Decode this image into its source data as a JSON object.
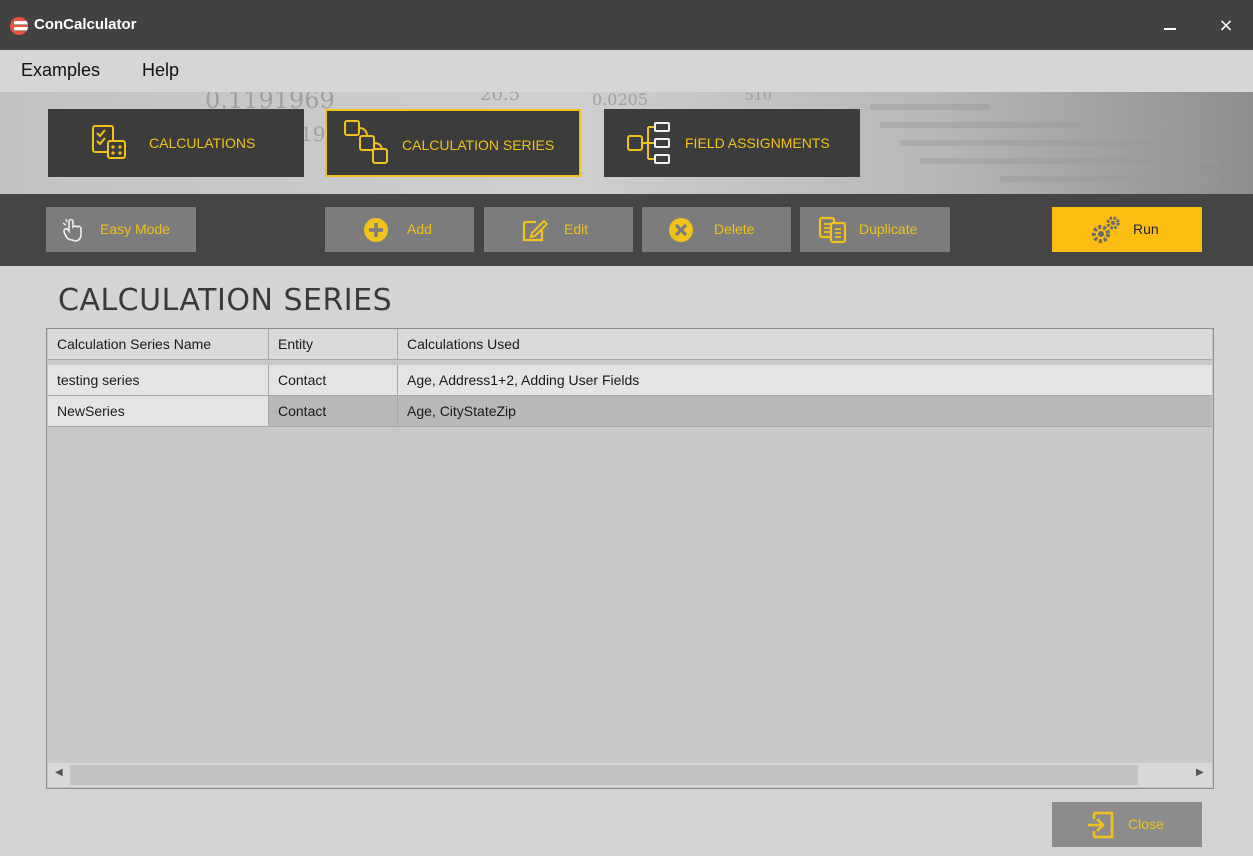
{
  "window": {
    "title": "ConCalculator",
    "minimize_label": "–",
    "close_label": "×"
  },
  "menu": {
    "items": [
      "Examples",
      "Help"
    ]
  },
  "banner": {
    "bg_numbers": [
      "0.1191969",
      "20.5",
      "0.0205",
      "510",
      "19"
    ]
  },
  "nav_tabs": [
    {
      "label": "CALCULATIONS",
      "icon": "checklist-calculator-icon",
      "active": false
    },
    {
      "label": "CALCULATION SERIES",
      "icon": "calculation-series-icon",
      "active": true
    },
    {
      "label": "FIELD ASSIGNMENTS",
      "icon": "field-tree-icon",
      "active": false
    }
  ],
  "toolbar": {
    "easy_mode": "Easy Mode",
    "add": "Add",
    "edit": "Edit",
    "delete": "Delete",
    "duplicate": "Duplicate",
    "run": "Run"
  },
  "page_title": "CALCULATION SERIES",
  "table": {
    "columns": [
      "Calculation Series Name",
      "Entity",
      "Calculations Used"
    ],
    "rows": [
      [
        "testing series",
        "Contact",
        "Age, Address1+2, Adding User Fields"
      ],
      [
        "NewSeries",
        "Contact",
        "Age, CityStateZip"
      ]
    ]
  },
  "scroll": {
    "left_arrow": "◀",
    "right_arrow": "▶"
  },
  "close_button": "Close",
  "colors": {
    "accent": "#f0c21a",
    "run_bg": "#fbbd12",
    "titlebar": "#424242",
    "toolbar": "#454545"
  }
}
